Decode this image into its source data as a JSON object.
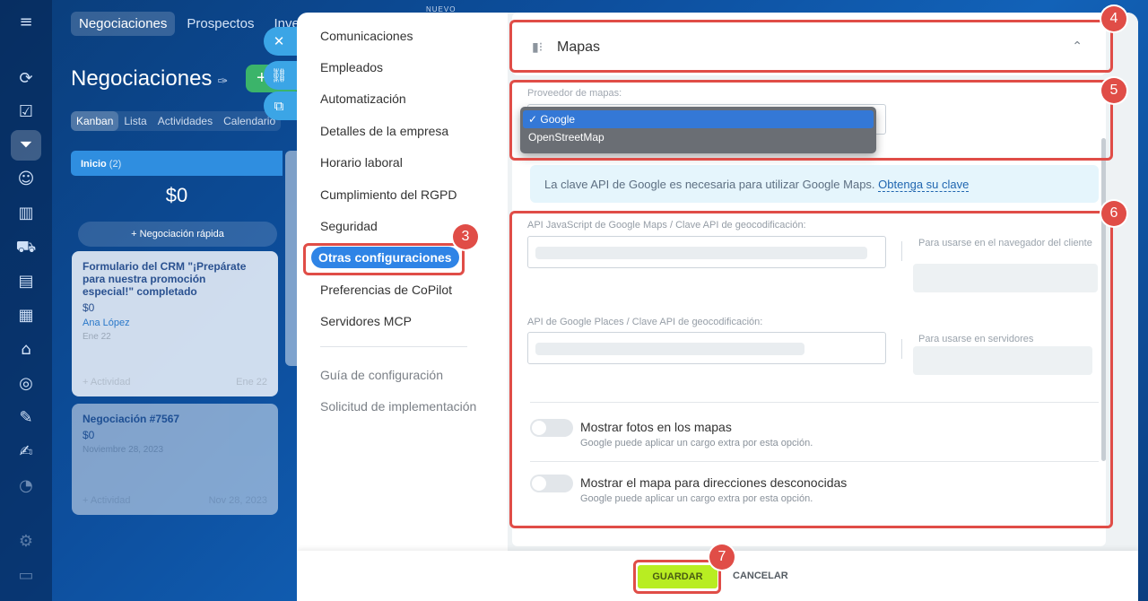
{
  "background": {
    "nav_tabs": [
      "Negociaciones",
      "Prospectos",
      "Inventario"
    ],
    "banner_tag": "NUEVO",
    "page_title": "Negociaciones",
    "view_tabs": [
      "Kanban",
      "Lista",
      "Actividades",
      "Calendario"
    ],
    "column": {
      "name": "Inicio",
      "count": "(2)",
      "amount": "$0",
      "quick_add": "+ Negociación rápida"
    },
    "cards": [
      {
        "title": "Formulario del CRM \"¡Prepárate para nuestra promoción especial!\" completado",
        "amount": "$0",
        "person": "Ana López",
        "date": "Ene 22",
        "badge": "0",
        "activity": "+ Actividad",
        "foot_date": "Ene 22"
      },
      {
        "title": "Negociación #7567",
        "amount": "$0",
        "person": "",
        "date": "Noviembre 28, 2023",
        "badge": "0",
        "activity": "+ Actividad",
        "foot_date": "Nov 28, 2023"
      }
    ]
  },
  "menu": {
    "items": [
      "Comunicaciones",
      "Empleados",
      "Automatización",
      "Detalles de la empresa",
      "Horario laboral",
      "Cumplimiento del RGPD",
      "Seguridad",
      "Otras configuraciones",
      "Preferencias de CoPilot",
      "Servidores MCP"
    ],
    "active_index": 7,
    "secondary": [
      "Guía de configuración",
      "Solicitud de implementación"
    ]
  },
  "section": {
    "title": "Mapas",
    "provider_label": "Proveedor de mapas:",
    "provider_options": [
      {
        "label": "✓ Google",
        "selected": true
      },
      {
        "label": "OpenStreetMap",
        "selected": false
      }
    ],
    "info_text": "La clave API de Google es necesaria para utilizar Google Maps.",
    "info_link": "Obtenga su clave",
    "fields": [
      {
        "label": "API JavaScript de Google Maps / Clave API de geocodificación:",
        "hint": "Para usarse en el navegador del cliente"
      },
      {
        "label": "API de Google Places / Clave API de geocodificación:",
        "hint": "Para usarse en servidores"
      }
    ],
    "toggles": [
      {
        "title": "Mostrar fotos en los mapas",
        "subtitle": "Google puede aplicar un cargo extra por esta opción.",
        "on": false
      },
      {
        "title": "Mostrar el mapa para direcciones desconocidas",
        "subtitle": "Google puede aplicar un cargo extra por esta opción.",
        "on": false
      }
    ]
  },
  "footer": {
    "save": "GUARDAR",
    "cancel": "CANCELAR"
  },
  "annotations": [
    "3",
    "4",
    "5",
    "6",
    "7"
  ],
  "colors": {
    "accent": "#2f84e6",
    "save": "#b8ed22",
    "annotation": "#e04d47"
  }
}
